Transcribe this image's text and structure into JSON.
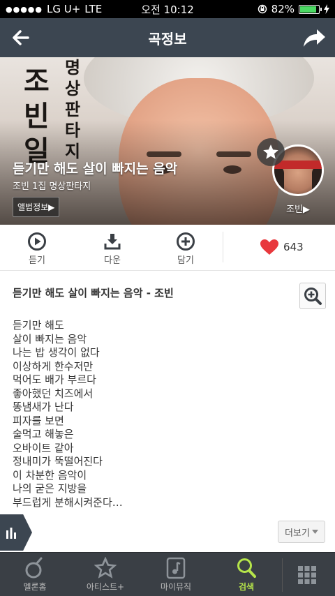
{
  "status_bar": {
    "carrier": "LG U+",
    "network": "LTE",
    "time": "오전 10:12",
    "battery": "82%",
    "battery_level": 0.82
  },
  "header": {
    "title": "곡정보",
    "back_icon": "arrow-left-icon",
    "share_icon": "share-arrow-icon"
  },
  "hero": {
    "song_title": "듣기만 해도 살이 빠지는 음악",
    "album_line": "조빈 1집 명상판타지",
    "album_button": "앨범정보▶",
    "artist_label": "조빈▶",
    "calligraphy_left": "조빈일",
    "calligraphy_right": "명상판타지"
  },
  "actions": {
    "play_label": "듣기",
    "download_label": "다운",
    "add_label": "담기",
    "like_count": "643",
    "like_color": "#e8383d"
  },
  "lyrics": {
    "heading": "듣기만 해도 살이 빠지는 음악 - 조빈",
    "lines": [
      "듣기만 해도",
      "살이 빠지는 음악",
      "나는 밥 생각이 없다",
      "이상하게 한수저만",
      "먹어도 배가 부르다",
      "좋아했던 치즈에서",
      "똥냄새가 난다",
      "피자를 보면",
      "술먹고 해놓은",
      "오바이트 같아",
      "정내미가 뚝떨어진다",
      "이 차분한 음악이",
      "나의 굳은 지방을",
      "부드럽게 분해시켜준다…"
    ],
    "more_button": "더보기"
  },
  "tab_bar": {
    "items": [
      {
        "label": "멜론홈",
        "icon": "melon-home-icon"
      },
      {
        "label": "아티스트+",
        "icon": "star-icon"
      },
      {
        "label": "마이뮤직",
        "icon": "music-note-icon"
      },
      {
        "label": "검색",
        "icon": "search-icon"
      }
    ],
    "active": "검색",
    "active_color": "#b6e54a",
    "grid_icon": "grid-menu-icon"
  }
}
